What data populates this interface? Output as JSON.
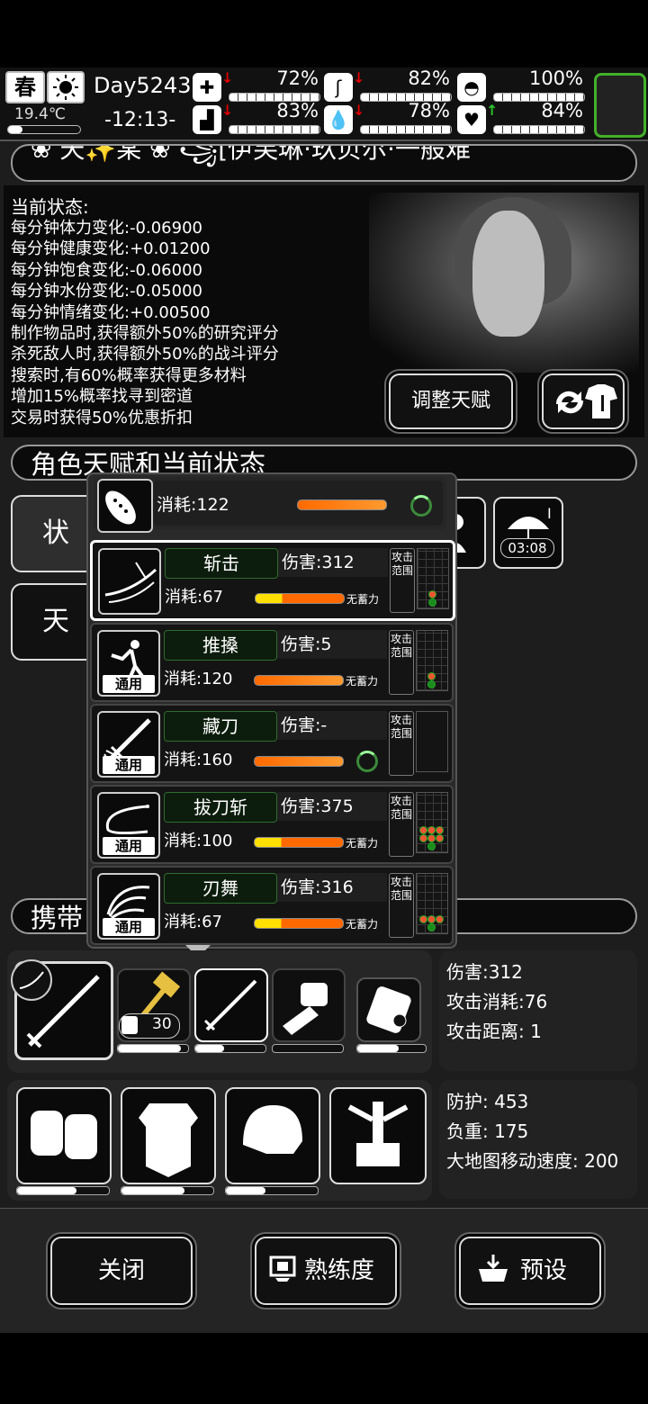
{
  "hud": {
    "season": "春",
    "temperature": "19.4℃",
    "day": "Day5243",
    "clock": "-12:13-",
    "stats": [
      {
        "icon": "medkit-icon",
        "pct": "72%",
        "trend": "down",
        "color": "#e00000"
      },
      {
        "icon": "stomach-icon",
        "pct": "82%",
        "trend": "down",
        "color": "#e00000"
      },
      {
        "icon": "mask-icon",
        "pct": "100%",
        "trend": "none",
        "color": ""
      },
      {
        "icon": "boot-icon",
        "pct": "83%",
        "trend": "down",
        "color": "#e00000"
      },
      {
        "icon": "water-icon",
        "pct": "78%",
        "trend": "down",
        "color": "#e00000"
      },
      {
        "icon": "heart-icon",
        "pct": "84%",
        "trend": "up",
        "color": "#29c629"
      }
    ]
  },
  "banner": {
    "text": "❀ 天✨某 ❀ ꧁[伊芙琳·玖贝尔·一般难"
  },
  "status": {
    "title": "当前状态:",
    "lines": [
      "每分钟体力变化:-0.06900",
      "每分钟健康变化:+0.01200",
      "每分钟饱食变化:-0.06000",
      "每分钟水份变化:-0.05000",
      "每分钟情绪变化:+0.00500",
      "制作物品时,获得额外50%的研究评分",
      "杀死敌人时,获得额外50%的战斗评分",
      "搜索时,有60%概率获得更多材料",
      "增加15%概率找寻到密道",
      "交易时获得50%优惠折扣"
    ],
    "adjust_button": "调整天赋"
  },
  "section_talent": "角色天赋和当前状态",
  "behind": {
    "tab1": "状",
    "tab2": "天",
    "timer": "03:08",
    "section_carry": "携带"
  },
  "popup": {
    "top_cost": "消耗:122",
    "skills": [
      {
        "name": "斩击",
        "damage": "伤害:312",
        "cost": "消耗:67",
        "note": "无蓄力",
        "tag": "",
        "bar": "y",
        "range_label": "攻击范围"
      },
      {
        "name": "推搡",
        "damage": "伤害:5",
        "cost": "消耗:120",
        "note": "无蓄力",
        "tag": "通用",
        "bar": "o",
        "range_label": "攻击范围"
      },
      {
        "name": "藏刀",
        "damage": "伤害:-",
        "cost": "消耗:160",
        "note": "",
        "tag": "通用",
        "bar": "o",
        "range_label": "攻击范围"
      },
      {
        "name": "拔刀斩",
        "damage": "伤害:375",
        "cost": "消耗:100",
        "note": "无蓄力",
        "tag": "通用",
        "bar": "y",
        "range_label": "攻击范围"
      },
      {
        "name": "刃舞",
        "damage": "伤害:316",
        "cost": "消耗:67",
        "note": "无蓄力",
        "tag": "通用",
        "bar": "y",
        "range_label": "攻击范围"
      }
    ]
  },
  "weapons": {
    "ammo_count": "30",
    "info": [
      "伤害:312",
      "攻击消耗:76",
      "攻击距离: 1"
    ]
  },
  "armor": {
    "info": [
      "防护: 453",
      "负重: 175",
      "大地图移动速度: 200"
    ]
  },
  "footer": {
    "close": "关闭",
    "proficiency": "熟练度",
    "preset": "预设"
  },
  "colors": {
    "accent_green": "#43b02a",
    "energy_orange": "#ff7a1a",
    "energy_yellow": "#ffe000"
  }
}
